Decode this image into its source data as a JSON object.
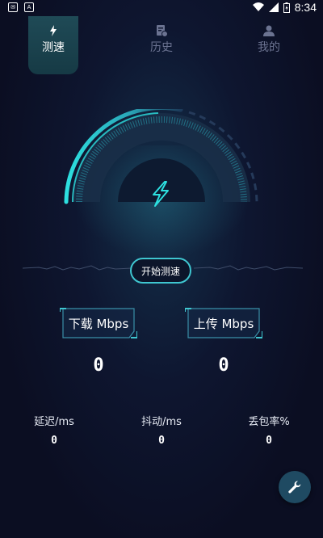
{
  "status_bar": {
    "time": "8:34"
  },
  "tabs": [
    {
      "label": "测速",
      "icon": "lightning-icon",
      "active": true
    },
    {
      "label": "历史",
      "icon": "history-icon",
      "active": false
    },
    {
      "label": "我的",
      "icon": "person-icon",
      "active": false
    }
  ],
  "gauge": {
    "icon": "lightning-icon"
  },
  "start_button": {
    "label": "开始测速"
  },
  "download": {
    "label": "下载 Mbps",
    "value": "0"
  },
  "upload": {
    "label": "上传 Mbps",
    "value": "0"
  },
  "metrics": [
    {
      "label": "延迟/ms",
      "value": "0"
    },
    {
      "label": "抖动/ms",
      "value": "0"
    },
    {
      "label": "丢包率%",
      "value": "0"
    }
  ],
  "fab": {
    "icon": "wrench-icon"
  },
  "colors": {
    "accent": "#2de0e0",
    "background": "#0c0f24",
    "tab_active": "#1f4a56"
  }
}
